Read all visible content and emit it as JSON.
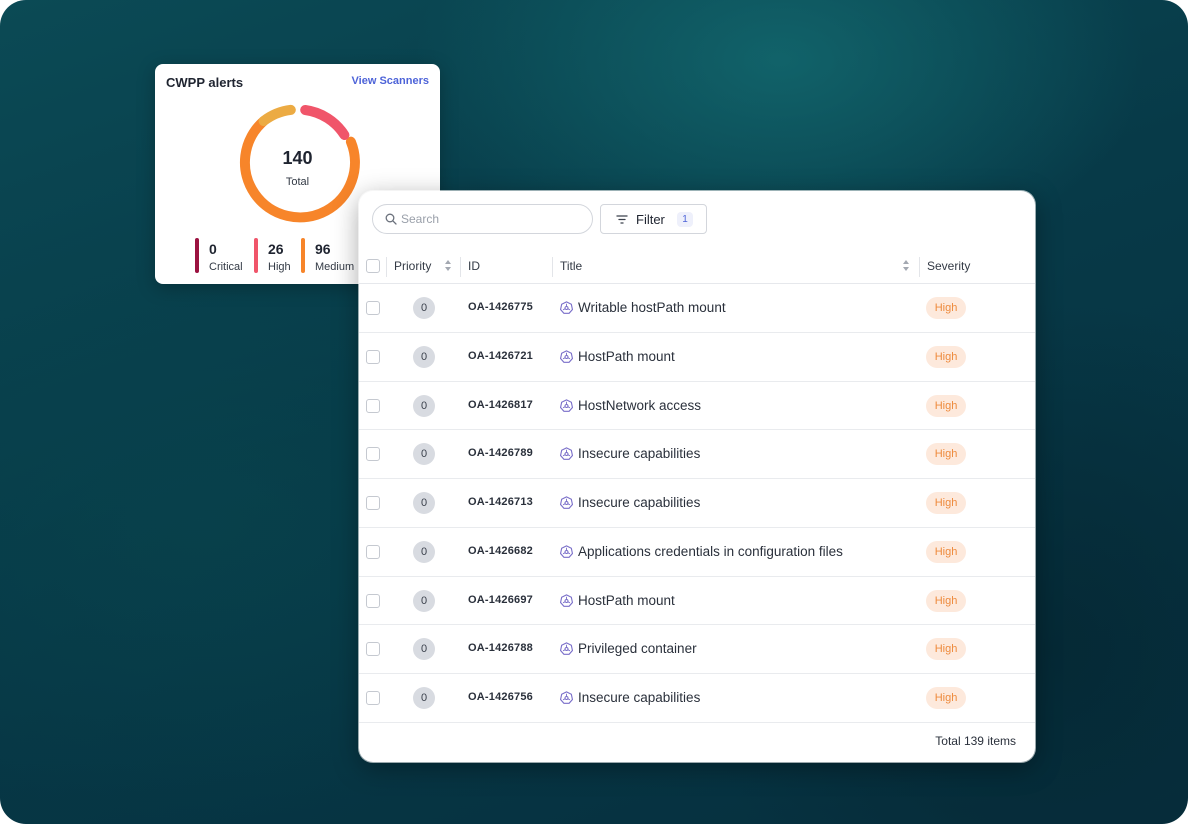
{
  "cwpp": {
    "title": "CWPP alerts",
    "link": "View Scanners",
    "total_value": "140",
    "total_label": "Total",
    "legend": [
      {
        "value": "0",
        "label": "Critical",
        "color": "#9b1240"
      },
      {
        "value": "26",
        "label": "High",
        "color": "#f0556a"
      },
      {
        "value": "96",
        "label": "Medium",
        "color": "#f7852a"
      }
    ],
    "donut_colors": {
      "critical": "#9b1240",
      "high": "#f0556a",
      "medium": "#f7852a",
      "low": "#ecab43"
    }
  },
  "toolbar": {
    "search_placeholder": "Search",
    "filter_label": "Filter",
    "filter_count": "1"
  },
  "table": {
    "headers": {
      "priority": "Priority",
      "id": "ID",
      "title": "Title",
      "severity": "Severity"
    },
    "rows": [
      {
        "priority": "0",
        "id": "OA-1426775",
        "title": "Writable hostPath mount",
        "severity": "High"
      },
      {
        "priority": "0",
        "id": "OA-1426721",
        "title": "HostPath mount",
        "severity": "High"
      },
      {
        "priority": "0",
        "id": "OA-1426817",
        "title": "HostNetwork access",
        "severity": "High"
      },
      {
        "priority": "0",
        "id": "OA-1426789",
        "title": "Insecure capabilities",
        "severity": "High"
      },
      {
        "priority": "0",
        "id": "OA-1426713",
        "title": "Insecure capabilities",
        "severity": "High"
      },
      {
        "priority": "0",
        "id": "OA-1426682",
        "title": "Applications credentials in configuration files",
        "severity": "High"
      },
      {
        "priority": "0",
        "id": "OA-1426697",
        "title": "HostPath mount",
        "severity": "High"
      },
      {
        "priority": "0",
        "id": "OA-1426788",
        "title": "Privileged container",
        "severity": "High"
      },
      {
        "priority": "0",
        "id": "OA-1426756",
        "title": "Insecure capabilities",
        "severity": "High"
      }
    ],
    "footer_total": "Total 139 items",
    "title_icon": "kubernetes-icon"
  }
}
